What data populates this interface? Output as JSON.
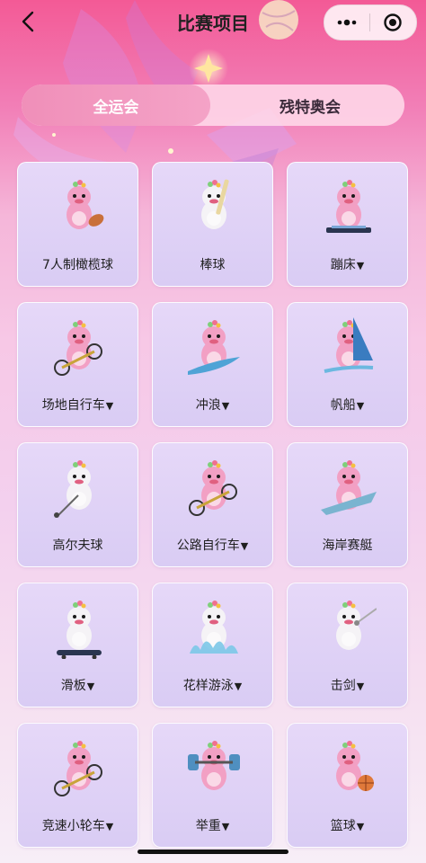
{
  "header": {
    "title": "比赛项目"
  },
  "tabs": [
    {
      "label": "全运会",
      "active": true
    },
    {
      "label": "残特奥会",
      "active": false
    }
  ],
  "sports": [
    {
      "name": "7人制橄榄球",
      "caret": "",
      "prop": "ball"
    },
    {
      "name": "棒球",
      "caret": "",
      "prop": "bat"
    },
    {
      "name": "蹦床",
      "caret": "▼",
      "prop": "tramp"
    },
    {
      "name": "场地自行车",
      "caret": "▼",
      "prop": "bike"
    },
    {
      "name": "冲浪",
      "caret": "▼",
      "prop": "surf"
    },
    {
      "name": "帆船",
      "caret": "▼",
      "prop": "sail"
    },
    {
      "name": "高尔夫球",
      "caret": "",
      "prop": "golf"
    },
    {
      "name": "公路自行车",
      "caret": "▼",
      "prop": "bike"
    },
    {
      "name": "海岸赛艇",
      "caret": "",
      "prop": "boat"
    },
    {
      "name": "滑板",
      "caret": "▼",
      "prop": "skate"
    },
    {
      "name": "花样游泳",
      "caret": "▼",
      "prop": "splash"
    },
    {
      "name": "击剑",
      "caret": "▼",
      "prop": "sword"
    },
    {
      "name": "竞速小轮车",
      "caret": "▼",
      "prop": "bike"
    },
    {
      "name": "举重",
      "caret": "▼",
      "prop": "weight"
    },
    {
      "name": "篮球",
      "caret": "▼",
      "prop": "basket"
    }
  ],
  "colors": {
    "mascot_pink": "#f2a0c4",
    "mascot_white": "#f5f3f6"
  }
}
